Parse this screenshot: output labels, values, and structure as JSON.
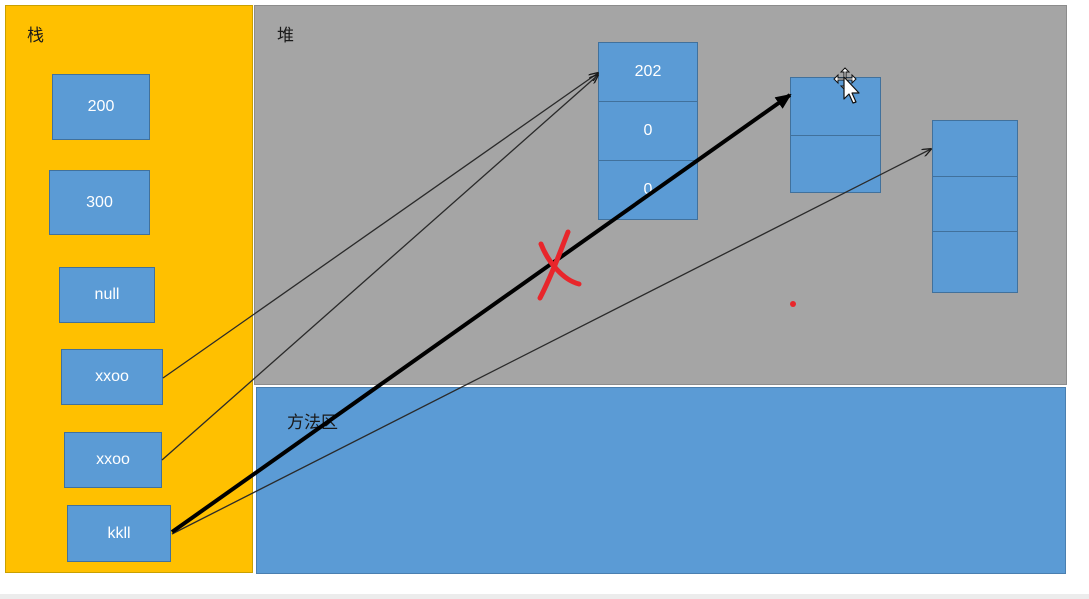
{
  "stack": {
    "title": "栈",
    "slots": [
      "200",
      "300",
      "null",
      "xxoo",
      "xxoo",
      "kkll"
    ]
  },
  "heap": {
    "title": "堆",
    "array1": [
      "202",
      "0",
      "0"
    ],
    "array2": [
      "",
      ""
    ],
    "array3": [
      "",
      "",
      ""
    ]
  },
  "method_area": {
    "title": "方法区"
  },
  "colors": {
    "stack": "#ffc000",
    "heap": "#a5a5a5",
    "block": "#5b9bd5",
    "cross_mark": "#e8262b"
  },
  "icons": [
    "move-cursor-icon"
  ]
}
